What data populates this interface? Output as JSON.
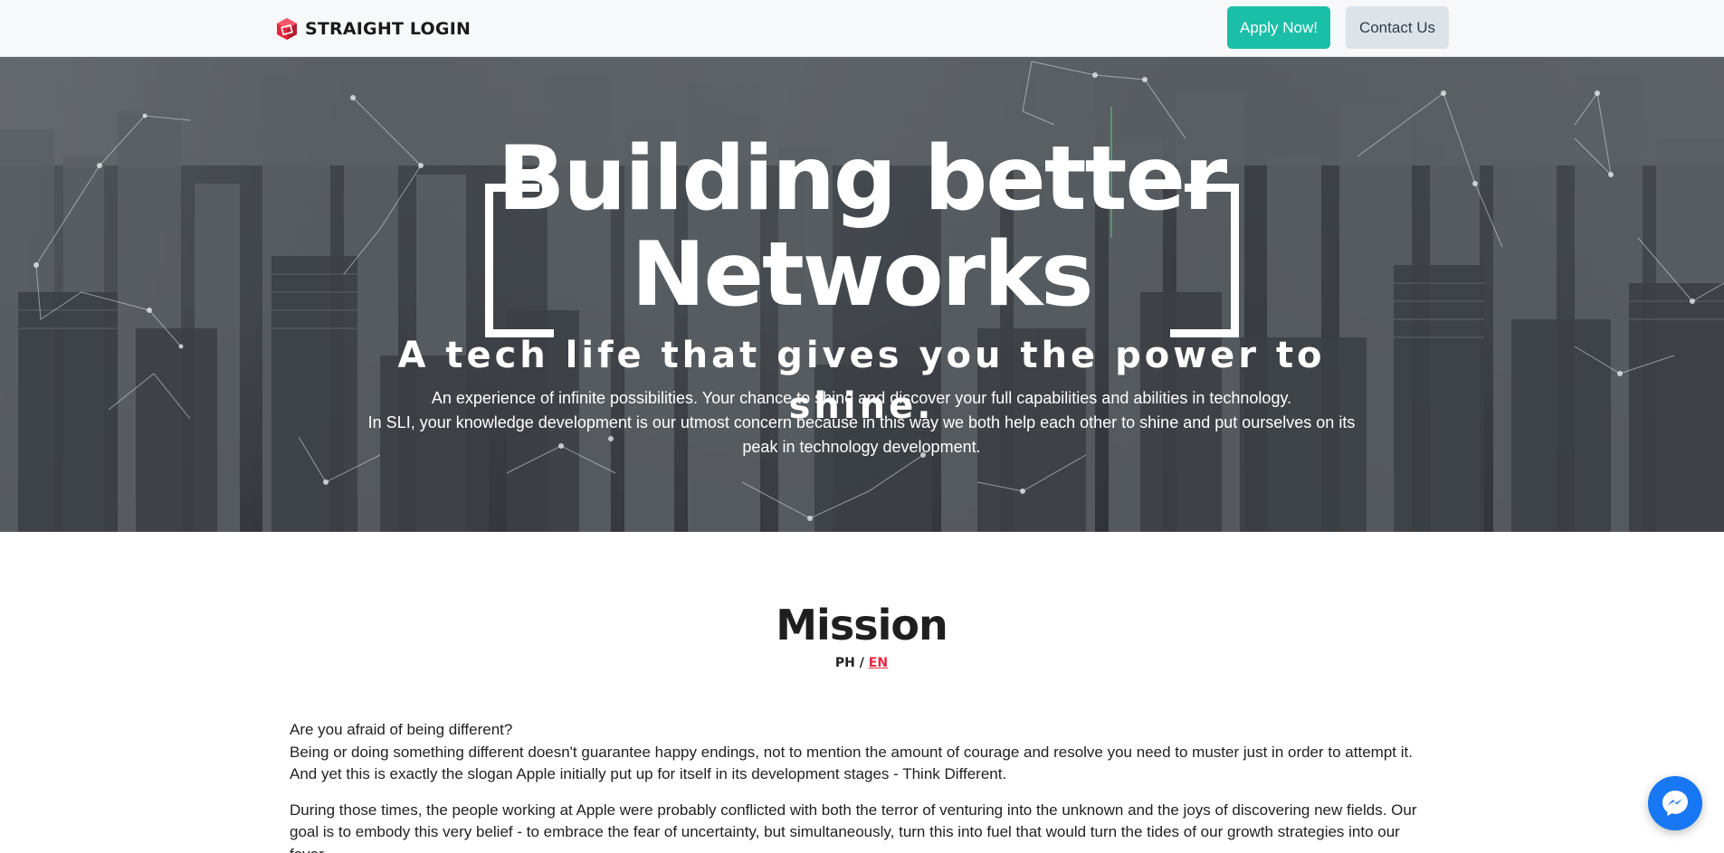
{
  "navbar": {
    "brand_text": "STRAIGHT LOGIN",
    "apply_label": "Apply Now!",
    "contact_label": "Contact Us",
    "brand_icon": "cube-logo-icon"
  },
  "hero": {
    "title_line1": "Building better",
    "title_line2": "Networks",
    "subtitle": "A tech life that gives you the power to shine.",
    "desc_line1": "An experience of infinite possibilities. Your chance to shine and discover your full capabilities and abilities in technology.",
    "desc_line2": "In SLI, your knowledge development is our utmost concern because in this way we both help each other to shine and put ourselves on its peak in technology development."
  },
  "mission": {
    "title": "Mission",
    "lang_ph": "PH",
    "lang_separator": " / ",
    "lang_en": "EN",
    "paragraph1_line1": "Are you afraid of being different?",
    "paragraph1_line2": "Being or doing something different doesn't guarantee happy endings, not to mention the amount of courage and resolve you need to muster just in order to attempt it.",
    "paragraph1_line3": "And yet this is exactly the slogan Apple initially put up for itself in its development stages - Think Different.",
    "paragraph2": "During those times, the people working at Apple were probably conflicted with both the terror of venturing into the unknown and the joys of discovering new fields. Our goal is to embody this very belief - to embrace the fear of uncertainty, but simultaneously, turn this into fuel that would turn the tides of our growth strategies into our favor."
  },
  "widgets": {
    "messenger_icon": "messenger-icon"
  },
  "colors": {
    "accent": "#1bbfa7",
    "contact_bg": "#dde4e9",
    "brand_red": "#e5283f",
    "messenger": "#1877f2"
  }
}
